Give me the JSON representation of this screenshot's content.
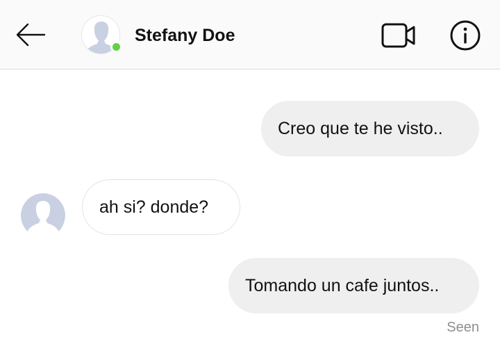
{
  "header": {
    "contact_name": "Stefany Doe",
    "online_status_color": "#5fd33f",
    "icons": {
      "back": "back-arrow-icon",
      "video": "video-camera-icon",
      "info": "info-icon",
      "avatar": "default-avatar-icon"
    }
  },
  "messages": [
    {
      "direction": "outgoing",
      "text": "Creo que te he visto.."
    },
    {
      "direction": "incoming",
      "text": "ah si? donde?"
    },
    {
      "direction": "outgoing",
      "text": "Tomando un cafe juntos.."
    }
  ],
  "receipt": {
    "label": "Seen"
  },
  "colors": {
    "outgoing_bubble": "#efefef",
    "incoming_border": "#e3e3e3",
    "avatar_placeholder": "#c8d0e2",
    "seen_text": "#8e8e8e"
  }
}
